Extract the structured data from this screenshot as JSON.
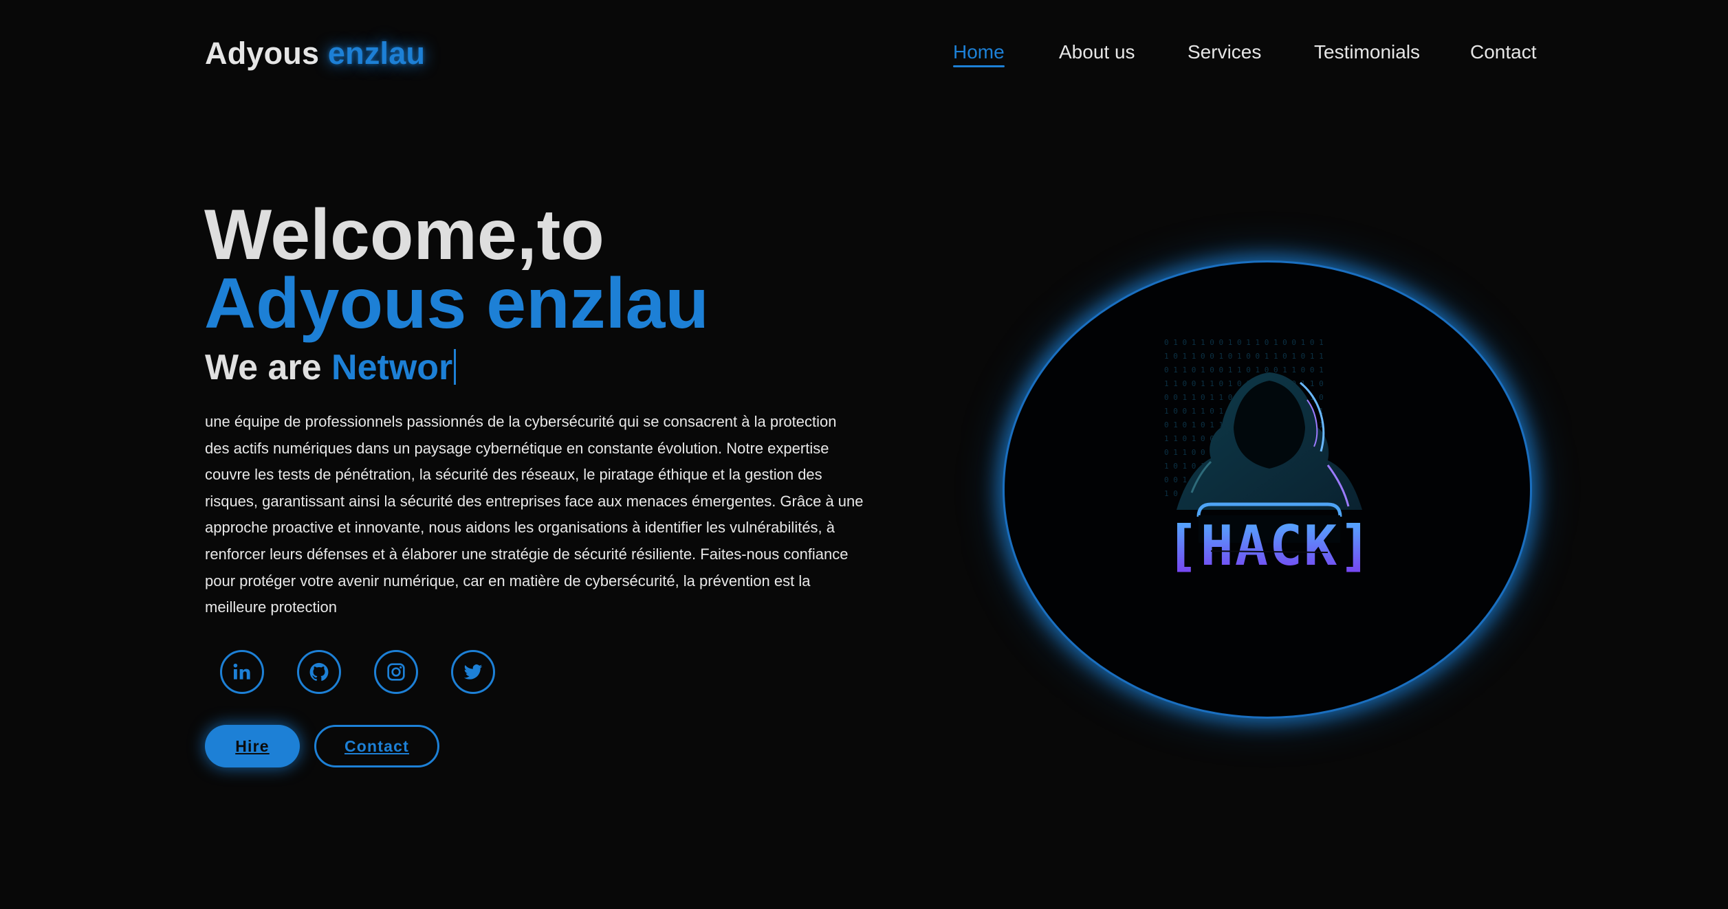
{
  "header": {
    "logo_part1": "Adyous",
    "logo_part2": "enzlau",
    "nav": [
      {
        "label": "Home",
        "active": true
      },
      {
        "label": "About us",
        "active": false
      },
      {
        "label": "Services",
        "active": false
      },
      {
        "label": "Testimonials",
        "active": false
      },
      {
        "label": "Contact",
        "active": false
      }
    ]
  },
  "hero": {
    "line1": "Welcome,to",
    "line2": "Adyous enzlau",
    "typing_prefix": "We are",
    "typing_text": "Networ",
    "description": "une équipe de professionnels passionnés de la cybersécurité qui se consacrent à la protection des actifs numériques dans un paysage cybernétique en constante évolution. Notre expertise couvre les tests de pénétration, la sécurité des réseaux, le piratage éthique et la gestion des risques, garantissant ainsi la sécurité des entreprises face aux menaces émergentes. Grâce à une approche proactive et innovante, nous aidons les organisations à identifier les vulnérabilités, à renforcer leurs défenses et à élaborer une stratégie de sécurité résiliente. Faites-nous confiance pour protéger votre avenir numérique, car en matière de cybersécurité, la prévention est la meilleure protection",
    "socials": [
      "linkedin-icon",
      "github-icon",
      "instagram-icon",
      "twitter-icon"
    ],
    "buttons": {
      "hire": "Hire",
      "contact": "Contact"
    },
    "image_text": "[HACK]"
  },
  "colors": {
    "accent": "#1d80d6",
    "background": "#080808",
    "text": "#e6e6e6"
  }
}
